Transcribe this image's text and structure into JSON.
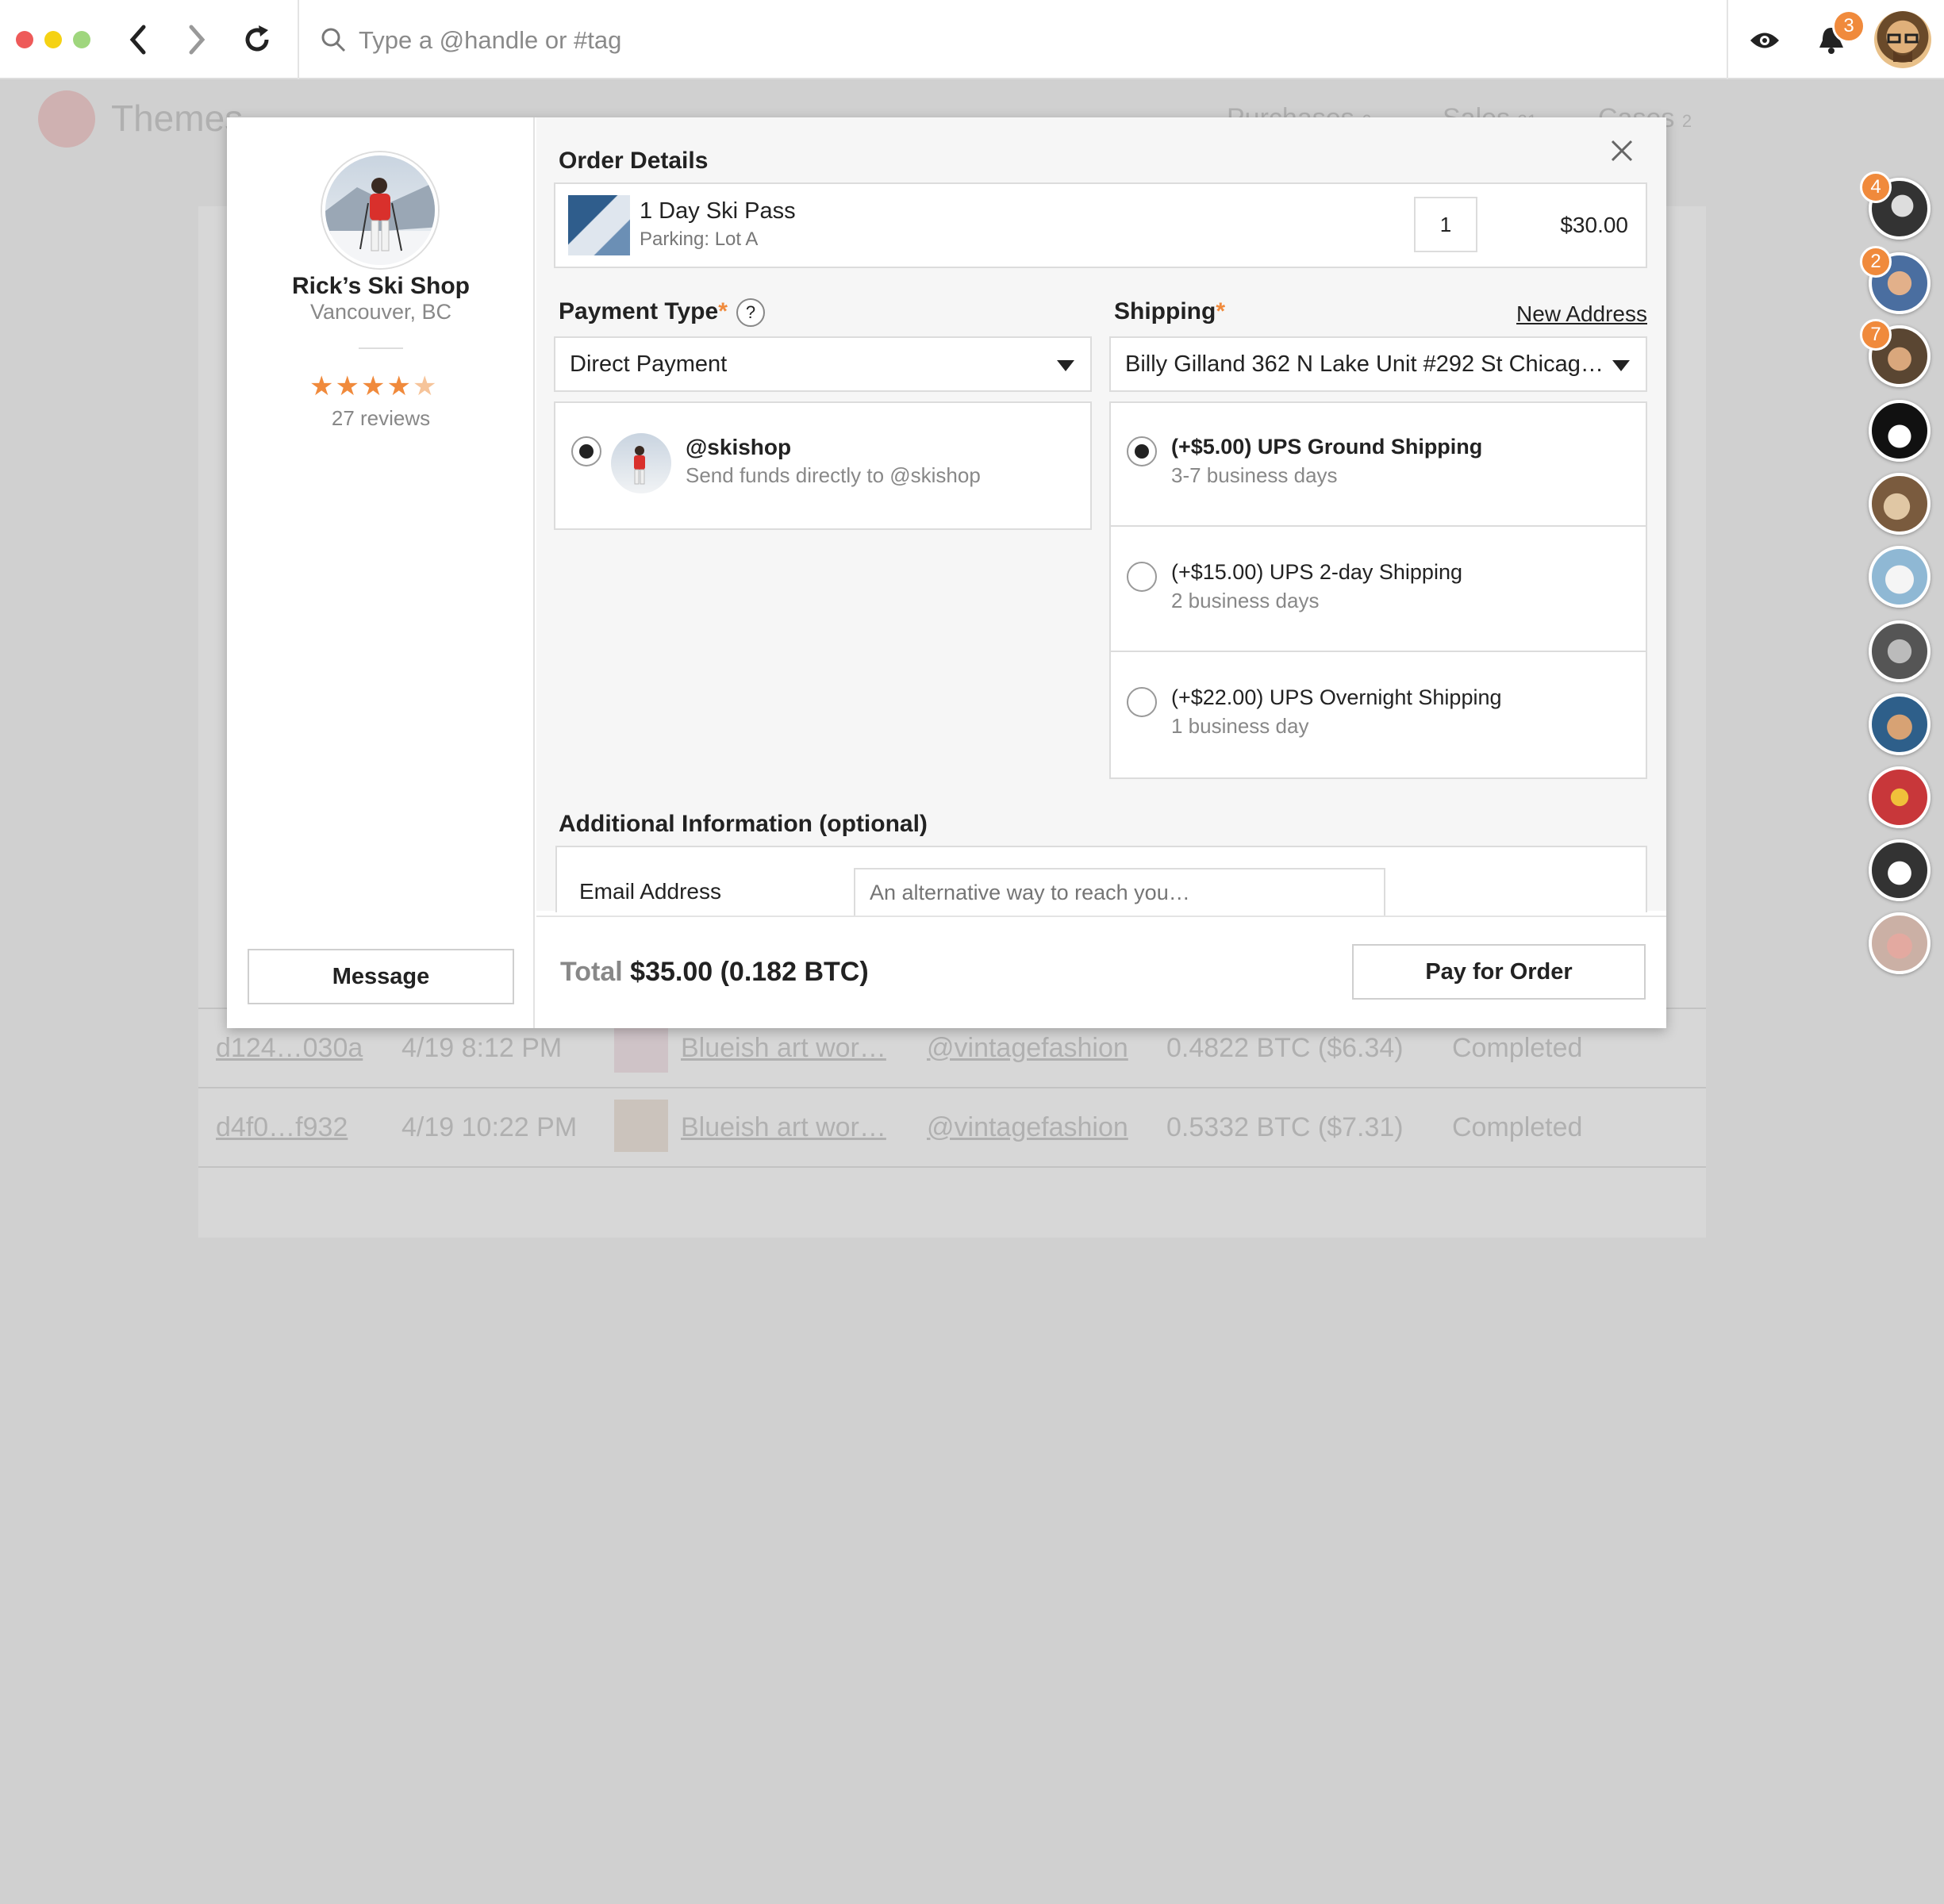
{
  "topbar": {
    "search_placeholder": "Type a @handle or #tag",
    "notifications_count": "3"
  },
  "background": {
    "brand": "Themes",
    "tabs": [
      {
        "label": "Purchases",
        "count": "6"
      },
      {
        "label": "Sales",
        "count": "21"
      },
      {
        "label": "Cases",
        "count": "2"
      }
    ],
    "rows": [
      {
        "id": "d124…030a",
        "date": "4/19 8:12 PM",
        "item": "Blueish art wor…",
        "vendor": "@vintagefashion",
        "price": "0.4822 BTC ($6.34)",
        "status": "Completed"
      },
      {
        "id": "d4f0…f932",
        "date": "4/19 10:22 PM",
        "item": "Blueish art wor…",
        "vendor": "@vintagefashion",
        "price": "0.5332 BTC ($7.31)",
        "status": "Completed"
      }
    ]
  },
  "side_avatars": [
    {
      "badge": "4"
    },
    {
      "badge": "2"
    },
    {
      "badge": "7"
    },
    {},
    {},
    {},
    {},
    {},
    {},
    {},
    {}
  ],
  "store": {
    "name": "Rick’s Ski Shop",
    "location": "Vancouver, BC",
    "rating": 4.5,
    "reviews": "27 reviews",
    "message_label": "Message"
  },
  "order": {
    "title": "Order Details",
    "item_name": "1 Day Ski Pass",
    "item_sub": "Parking: Lot A",
    "quantity": "1",
    "price": "$30.00"
  },
  "payment": {
    "label": "Payment Type",
    "help": "?",
    "selected": "Direct Payment",
    "option_handle": "@skishop",
    "option_desc": "Send funds directly to @skishop"
  },
  "shipping": {
    "label": "Shipping",
    "new_address": "New Address",
    "address": "Billy Gilland 362 N Lake Unit #292 St Chicag…",
    "options": [
      {
        "title": "(+$5.00) UPS Ground Shipping",
        "sub": "3-7 business days",
        "selected": true
      },
      {
        "title": "(+$15.00) UPS 2-day Shipping",
        "sub": "2 business days",
        "selected": false
      },
      {
        "title": "(+$22.00) UPS Overnight Shipping",
        "sub": "1 business day",
        "selected": false
      }
    ]
  },
  "additional": {
    "title": "Additional Information (optional)",
    "email_label": "Email Address",
    "email_placeholder": "An alternative way to reach you…"
  },
  "footer": {
    "total_label": "Total",
    "total_value": "$35.00 (0.182 BTC)",
    "pay_label": "Pay for Order"
  },
  "colors": {
    "accent": "#f08a3c",
    "overlay": "#d0d0d0",
    "close_red": "#ee5a59",
    "min_yellow": "#f5d214",
    "max_green": "#9fd67d"
  }
}
